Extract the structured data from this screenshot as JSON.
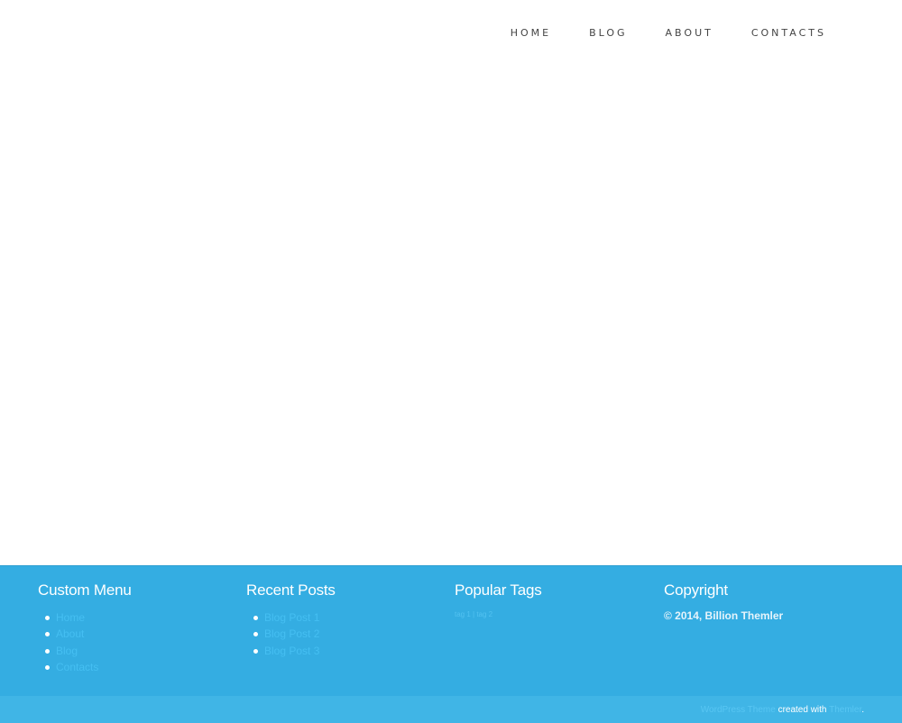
{
  "nav": {
    "items": [
      {
        "label": "HOME"
      },
      {
        "label": "BLOG"
      },
      {
        "label": "ABOUT"
      },
      {
        "label": "CONTACTS"
      }
    ]
  },
  "footer": {
    "custom_menu": {
      "title": "Custom Menu",
      "items": [
        "Home",
        "About",
        "Blog",
        "Contacts"
      ]
    },
    "recent_posts": {
      "title": "Recent Posts",
      "items": [
        "Blog Post 1",
        "Blog Post 2",
        "Blog Post 3"
      ]
    },
    "popular_tags": {
      "title": "Popular Tags",
      "tags": [
        "tag 1",
        "tag 2"
      ],
      "separator": " | "
    },
    "copyright": {
      "title": "Copyright",
      "text": "© 2014, Billion Themler"
    }
  },
  "bottom_bar": {
    "theme_link": "WordPress Theme",
    "created_with": " created with ",
    "tool_link": "Themler",
    "suffix": "."
  },
  "colors": {
    "footer_bg": "#34ade2",
    "bottom_bg": "#40b5e6",
    "link_color": "#45bff2"
  }
}
